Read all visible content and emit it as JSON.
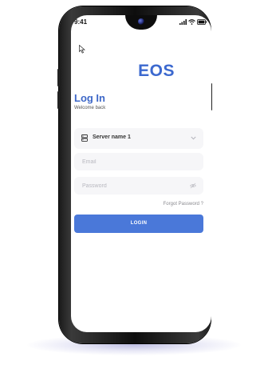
{
  "status_bar": {
    "time": "9:41",
    "icons": [
      "signal-icon",
      "wifi-icon",
      "battery-icon"
    ]
  },
  "app": {
    "logo": "EOS",
    "accent_color": "#3c69cf"
  },
  "login": {
    "title": "Log In",
    "subtitle": "Welcome back",
    "server_select": {
      "value": "Server name 1",
      "icon": "server-icon"
    },
    "email": {
      "value": "",
      "placeholder": "Email"
    },
    "password": {
      "value": "",
      "placeholder": "Password",
      "icon": "eye-off-icon"
    },
    "forgot_password": "Forgot Password ?",
    "login_button": "LOGIN"
  },
  "colors": {
    "primary": "#4a78d9",
    "field_bg": "#f6f6f8",
    "device_frame": "#111111"
  }
}
